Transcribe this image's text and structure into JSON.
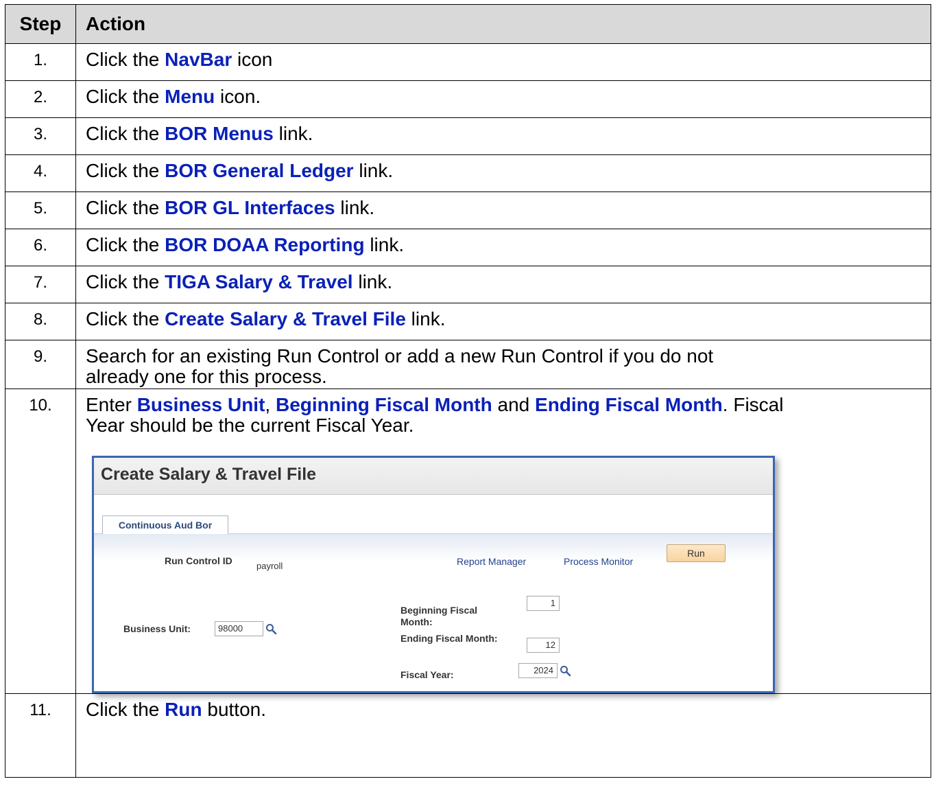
{
  "table": {
    "header_step": "Step",
    "header_action": "Action",
    "rows": [
      {
        "num": "1.",
        "pre": "Click the ",
        "hl": "NavBar",
        "post": " icon"
      },
      {
        "num": "2.",
        "pre": "Click the ",
        "hl": "Menu",
        "post": " icon."
      },
      {
        "num": "3.",
        "pre": "Click the ",
        "hl": "BOR Menus",
        "post": " link."
      },
      {
        "num": "4.",
        "pre": "Click the ",
        "hl": "BOR General Ledger",
        "post": " link."
      },
      {
        "num": "5.",
        "pre": "Click the ",
        "hl": "BOR GL Interfaces",
        "post": " link."
      },
      {
        "num": "6.",
        "pre": "Click the ",
        "hl": "BOR DOAA Reporting",
        "post": " link."
      },
      {
        "num": "7.",
        "pre": "Click the ",
        "hl": "TIGA Salary & Travel",
        "post": " link."
      },
      {
        "num": "8.",
        "pre": "Click the ",
        "hl": "Create Salary & Travel File",
        "post": " link."
      }
    ],
    "row9": {
      "num": "9.",
      "line1": "Search for an existing Run Control or add a new Run Control if you do not",
      "line2": "already one for this process."
    },
    "row10": {
      "num": "10.",
      "pre": "Enter ",
      "hl1": "Business Unit",
      "sep1": ", ",
      "hl2": "Beginning Fiscal Month",
      "sep2": " and ",
      "hl3": "Ending Fiscal Month",
      "post": ". Fiscal",
      "line2": "Year should be the current Fiscal Year."
    },
    "row11": {
      "num": "11.",
      "pre": "Click the ",
      "hl": "Run",
      "post": " button."
    }
  },
  "screenshot": {
    "title": "Create Salary & Travel File",
    "tab": "Continuous Aud Bor",
    "run_control_label": "Run Control ID",
    "run_control_value": "payroll",
    "report_manager": "Report Manager",
    "process_monitor": "Process Monitor",
    "run_button": "Run",
    "business_unit_label": "Business Unit:",
    "business_unit_value": "98000",
    "begin_month_label_1": "Beginning Fiscal",
    "begin_month_label_2": "Month:",
    "begin_month_value": "1",
    "end_month_label": "Ending Fiscal Month:",
    "end_month_value": "12",
    "fiscal_year_label": "Fiscal Year:",
    "fiscal_year_value": "2024"
  },
  "colors": {
    "highlight": "#0a21b8",
    "header_bg": "#d9d9d9",
    "frame_border": "#3a66b4"
  }
}
